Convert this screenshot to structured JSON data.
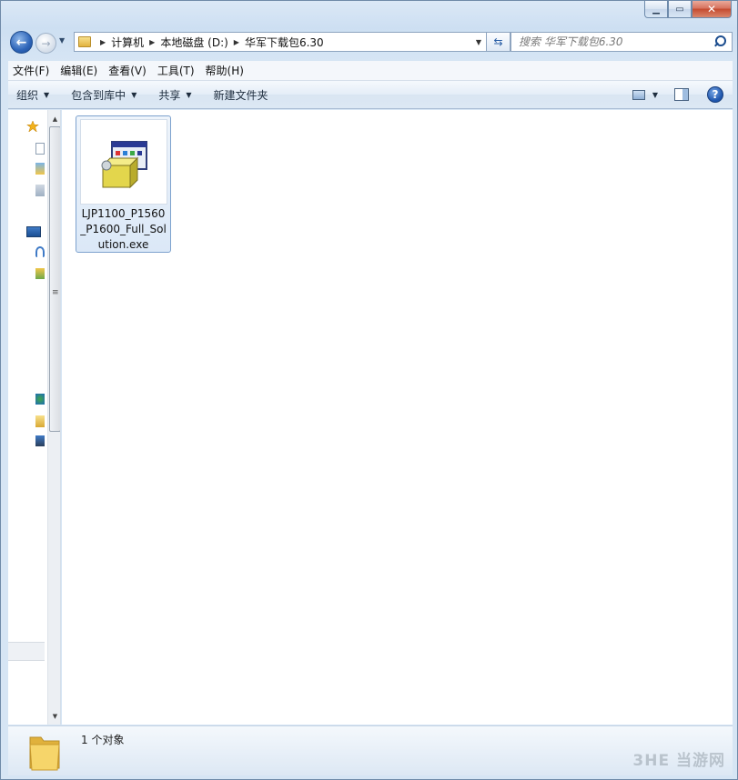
{
  "window": {
    "controls": {
      "minimize": "▁",
      "maximize": "▭",
      "close": "✕"
    }
  },
  "navigation": {
    "back_icon": "back-arrow-icon",
    "forward_icon": "forward-arrow-icon",
    "breadcrumbs": [
      "计算机",
      "本地磁盘 (D:)",
      "华军下载包6.30"
    ]
  },
  "search": {
    "placeholder": "搜索 华军下载包6.30"
  },
  "menu": {
    "items": [
      "文件(F)",
      "编辑(E)",
      "查看(V)",
      "工具(T)",
      "帮助(H)"
    ]
  },
  "commands": {
    "organize": "组织",
    "include_in_library": "包含到库中",
    "share": "共享",
    "new_folder": "新建文件夹",
    "help": "?"
  },
  "files": [
    {
      "name": "LJP1100_P1560_P1600_Full_Solution.exe",
      "icon": "installer-exe-icon"
    }
  ],
  "status": {
    "item_count": "1 个对象"
  },
  "watermark": "3HE 当游网",
  "colors": {
    "selection_border": "#7da2ce",
    "selection_fill": "#dbe8f7",
    "close_button": "#c54b30"
  }
}
